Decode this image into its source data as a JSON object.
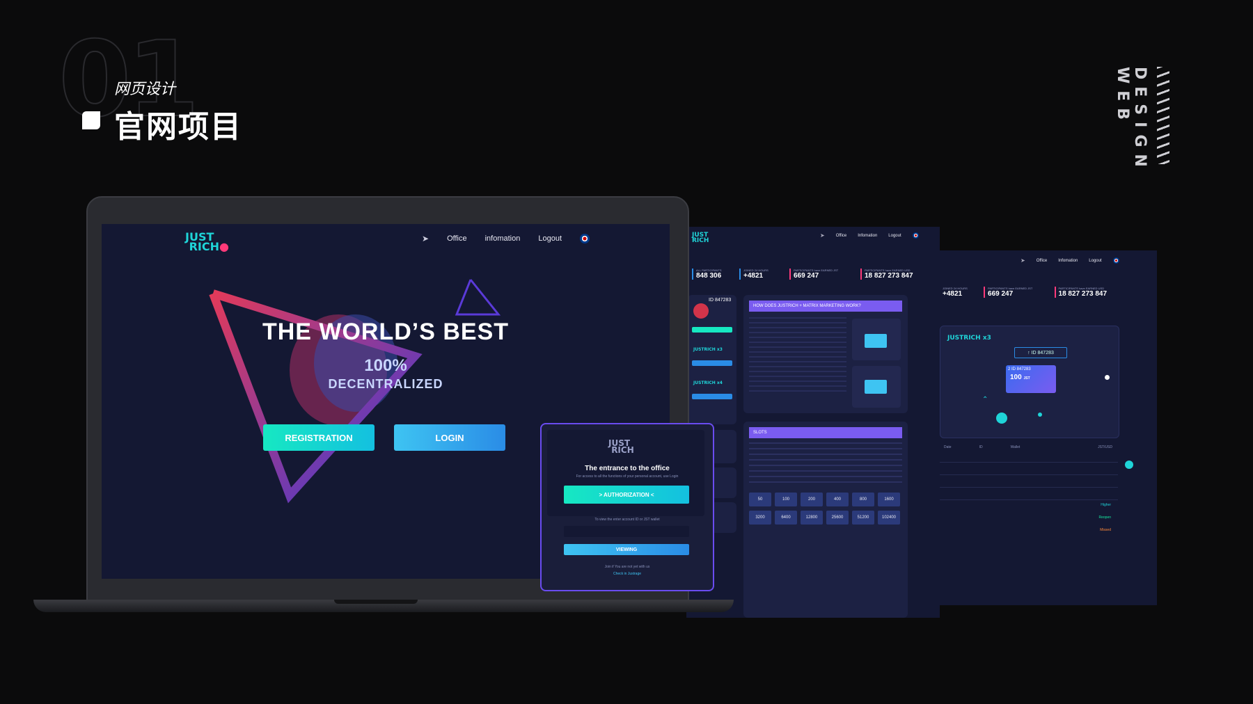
{
  "brand": {
    "number": "01",
    "subtitle_cn": "网页设计",
    "title_cn": "官网项目",
    "vertical_label": "DESIGN WEB"
  },
  "site": {
    "logo_top": "JUST",
    "logo_bottom": "RICH",
    "nav": [
      "Office",
      "infomation",
      "Logout"
    ],
    "hero_title": "THE WORLD’S BEST",
    "hero_percent": "100%",
    "hero_sub": "DECENTRALIZED",
    "btn_registration": "REGISTRATION",
    "btn_login": "LOGIN"
  },
  "modal": {
    "logo_top": "JUST",
    "logo_bottom": "RICH",
    "title": "The entrance to the office",
    "desc": "For access to all the functions of your personal account, use Login",
    "btn_auth": "> AUTHORIZATION <",
    "hint": "To view the enter account ID or JST wallet",
    "btn_view": "VIEWING",
    "footer": "Join if You are not yet with us",
    "footer_link": "Check in Justrage"
  },
  "dashboard": {
    "nav": [
      "Office",
      "Infomation",
      "Logout"
    ],
    "stats": [
      {
        "label": "ALL PARTICIPANTS",
        "value": "848 306"
      },
      {
        "label": "JOINED 24 HOURS",
        "value": "+4821"
      },
      {
        "label": "PARTICIPANTS have EARNED JST",
        "value": "669 247"
      },
      {
        "label": "PARTICIPANTS have EARNED USD",
        "value": "18 827 273 847"
      }
    ],
    "id": "ID 847283",
    "how_title": "HOW DOES JUSTRICH + MATRIX MARKETING WORK?",
    "slots_title": "SLOTS",
    "program_x3": "JUSTRICH x3",
    "program_x4": "JUSTRICH x4",
    "slot_values": [
      "50",
      "100",
      "200",
      "400",
      "800",
      "1600",
      "3200",
      "6400",
      "12800",
      "25600",
      "51200",
      "102400"
    ]
  },
  "detail": {
    "nav": [
      "Office",
      "Infomation",
      "Logout"
    ],
    "stats": [
      {
        "label": "JOINED 24 HOURS",
        "value": "+4821"
      },
      {
        "label": "PARTICIPANTS have EARNED JST",
        "value": "669 247"
      },
      {
        "label": "PARTICIPANTS have EARNED USD",
        "value": "18 827 273 847"
      }
    ],
    "program": "JUSTRICH x3",
    "id_badge": "↑ ID 847283",
    "id_inner": "2 ID 847283",
    "amount": "100",
    "amount_unit": "JST",
    "table_headers": [
      "Date",
      "ID",
      "Wallet",
      "JST/USD"
    ],
    "status_higher": "Higher",
    "status_reopen": "Reopen",
    "status_missed": "Missed"
  },
  "colors": {
    "accent_teal": "#16e8c2",
    "accent_blue": "#2a8ce6",
    "accent_purple": "#7a5cf0",
    "panel_bg": "#141833"
  }
}
